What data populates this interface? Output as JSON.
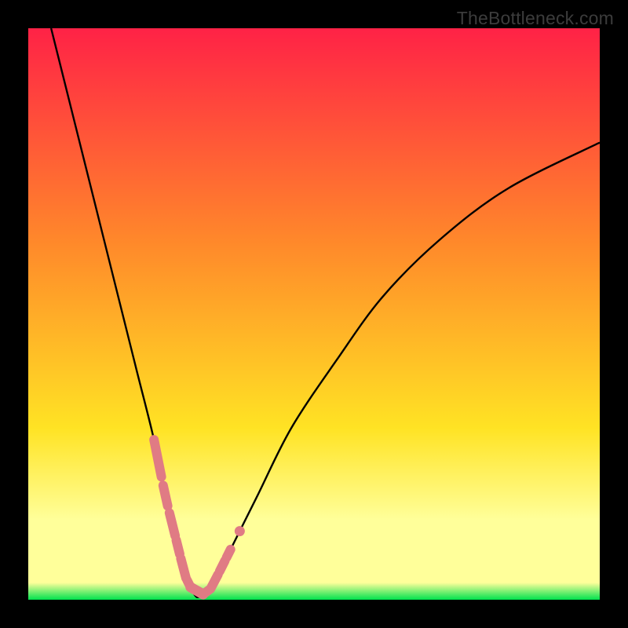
{
  "watermark": "TheBottleneck.com",
  "colors": {
    "top": "#ff2246",
    "mid_orange": "#ff8a2a",
    "mid_yellow": "#ffe324",
    "pale_yellow": "#ffff9a",
    "bottom_green": "#00e24e",
    "curve": "#000000",
    "segment": "#e07b84",
    "frame": "#000000"
  },
  "chart_data": {
    "type": "line",
    "title": "",
    "xlabel": "",
    "ylabel": "",
    "xlim": [
      0,
      100
    ],
    "ylim": [
      0,
      100
    ],
    "grid": false,
    "legend": false,
    "series": [
      {
        "name": "bottleneck-curve",
        "x": [
          4,
          8,
          12,
          16,
          19,
          22,
          24,
          26,
          27.5,
          29,
          30,
          32,
          35,
          40,
          46,
          54,
          62,
          72,
          84,
          100
        ],
        "y": [
          100,
          84,
          68,
          52,
          40,
          28,
          18,
          10,
          4,
          1,
          0.5,
          2,
          8,
          18,
          30,
          42,
          53,
          63,
          72,
          80
        ]
      }
    ],
    "highlight_segments": {
      "name": "marker-clusters",
      "description": "Pink rounded segments overlaying the V near its dip",
      "left_branch_x_range": [
        22,
        28.5
      ],
      "right_branch_x_range": [
        30.5,
        37
      ],
      "bottom_x_range": [
        28.5,
        30.5
      ],
      "bottom_y": 0.5
    },
    "annotations": [
      {
        "text": "TheBottleneck.com",
        "position": "top-right"
      }
    ]
  }
}
